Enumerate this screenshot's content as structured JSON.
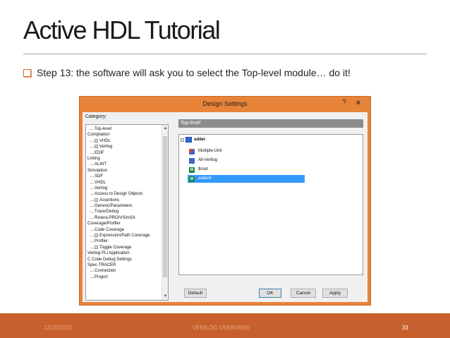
{
  "slide": {
    "title": "Active HDL Tutorial",
    "bullet": "Step 13: the software will ask you to select the Top-level module… do it!"
  },
  "dialog": {
    "title": "Design Settings",
    "help": "?",
    "close": "✕",
    "category_label": "Category:",
    "categories": [
      {
        "label": "Top-level",
        "level": 1
      },
      {
        "label": "Compilation",
        "level": 0
      },
      {
        "label": "VHDL",
        "level": 1,
        "expander": "+"
      },
      {
        "label": "Verilog",
        "level": 1,
        "expander": "+"
      },
      {
        "label": "EDIF",
        "level": 1
      },
      {
        "label": "Linting",
        "level": 0
      },
      {
        "label": "ALINT",
        "level": 1
      },
      {
        "label": "Simulation",
        "level": 0
      },
      {
        "label": "SDF",
        "level": 1
      },
      {
        "label": "VHDL",
        "level": 1
      },
      {
        "label": "Verilog",
        "level": 1
      },
      {
        "label": "Access to Design Objects",
        "level": 1
      },
      {
        "label": "Assertions",
        "level": 1,
        "expander": "+"
      },
      {
        "label": "Generic/Parameters",
        "level": 1
      },
      {
        "label": "Trace/Debug",
        "level": 1
      },
      {
        "label": "Riviera-PRO/VSimSA",
        "level": 1
      },
      {
        "label": "Coverage/Profiler",
        "level": 0
      },
      {
        "label": "Code Coverage",
        "level": 1
      },
      {
        "label": "Expression/Path Coverage",
        "level": 1,
        "expander": "+"
      },
      {
        "label": "Profiler",
        "level": 1
      },
      {
        "label": "Toggle Coverage",
        "level": 1,
        "expander": "+"
      },
      {
        "label": "Verilog PLI Application",
        "level": 0
      },
      {
        "label": "C Code Debug Settings",
        "level": 0
      },
      {
        "label": "Spec-TRACER",
        "level": 0
      },
      {
        "label": "Connection",
        "level": 1
      },
      {
        "label": "Project",
        "level": 1
      }
    ],
    "panel_header": "Top-level",
    "tree": {
      "root": "adder",
      "root_expander": "−",
      "items": [
        {
          "label": "Multiple-Unit",
          "icon": "multi-unit-icon",
          "selected": false
        },
        {
          "label": "All-Verilog",
          "icon": "all-verilog-icon",
          "selected": false
        },
        {
          "label": "$root",
          "icon": "module-icon",
          "glyph": "M",
          "selected": false
        },
        {
          "label": "adder4",
          "icon": "module-icon",
          "glyph": "M",
          "selected": true
        }
      ]
    },
    "buttons": {
      "default": "Default",
      "ok": "OK",
      "cancel": "Cancel",
      "apply": "Apply"
    }
  },
  "footer": {
    "date": "12/20/2015",
    "center": "VERILOG OVERVIEW",
    "page": "33"
  }
}
